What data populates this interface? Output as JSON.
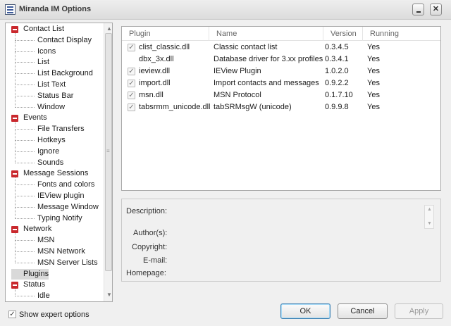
{
  "window": {
    "title": "Miranda IM Options"
  },
  "tree": {
    "items": [
      {
        "label": "Contact List",
        "level": 0,
        "expanded": true
      },
      {
        "label": "Contact Display",
        "level": 1
      },
      {
        "label": "Icons",
        "level": 1
      },
      {
        "label": "List",
        "level": 1
      },
      {
        "label": "List Background",
        "level": 1
      },
      {
        "label": "List Text",
        "level": 1
      },
      {
        "label": "Status Bar",
        "level": 1
      },
      {
        "label": "Window",
        "level": 1
      },
      {
        "label": "Events",
        "level": 0,
        "expanded": true
      },
      {
        "label": "File Transfers",
        "level": 1
      },
      {
        "label": "Hotkeys",
        "level": 1
      },
      {
        "label": "Ignore",
        "level": 1
      },
      {
        "label": "Sounds",
        "level": 1
      },
      {
        "label": "Message Sessions",
        "level": 0,
        "expanded": true
      },
      {
        "label": "Fonts and colors",
        "level": 1
      },
      {
        "label": "IEView plugin",
        "level": 1
      },
      {
        "label": "Message Window",
        "level": 1
      },
      {
        "label": "Typing Notify",
        "level": 1
      },
      {
        "label": "Network",
        "level": 0,
        "expanded": true
      },
      {
        "label": "MSN",
        "level": 1
      },
      {
        "label": "MSN Network",
        "level": 1
      },
      {
        "label": "MSN Server Lists",
        "level": 1
      },
      {
        "label": "Plugins",
        "level": 0,
        "selected": true
      },
      {
        "label": "Status",
        "level": 0,
        "expanded": true
      },
      {
        "label": "Idle",
        "level": 1
      }
    ]
  },
  "plugins": {
    "columns": {
      "plugin": "Plugin",
      "name": "Name",
      "version": "Version",
      "running": "Running"
    },
    "rows": [
      {
        "plugin": "clist_classic.dll",
        "name": "Classic contact list",
        "version": "0.3.4.5",
        "running": "Yes",
        "checked": true
      },
      {
        "plugin": "dbx_3x.dll",
        "name": "Database driver for 3.xx profiles",
        "version": "0.3.4.1",
        "running": "Yes",
        "checked": false
      },
      {
        "plugin": "ieview.dll",
        "name": "IEView Plugin",
        "version": "1.0.2.0",
        "running": "Yes",
        "checked": true
      },
      {
        "plugin": "import.dll",
        "name": "Import contacts and messages",
        "version": "0.9.2.2",
        "running": "Yes",
        "checked": true
      },
      {
        "plugin": "msn.dll",
        "name": "MSN Protocol",
        "version": "0.1.7.10",
        "running": "Yes",
        "checked": true
      },
      {
        "plugin": "tabsrmm_unicode.dll",
        "name": "tabSRMsgW (unicode)",
        "version": "0.9.9.8",
        "running": "Yes",
        "checked": true
      }
    ]
  },
  "details": {
    "description_label": "Description:",
    "authors_label": "Author(s):",
    "copyright_label": "Copyright:",
    "email_label": "E-mail:",
    "homepage_label": "Homepage:"
  },
  "footer": {
    "expert_label": "Show expert options",
    "expert_checked": true,
    "ok_label": "OK",
    "cancel_label": "Cancel",
    "apply_label": "Apply"
  },
  "colors": {
    "expander": "#c9282d",
    "ok_border": "#3c7fb1"
  },
  "icons": {
    "app": "miranda-options-icon",
    "minimize": "minimize-icon",
    "close": "close-icon",
    "check": "check-icon"
  }
}
